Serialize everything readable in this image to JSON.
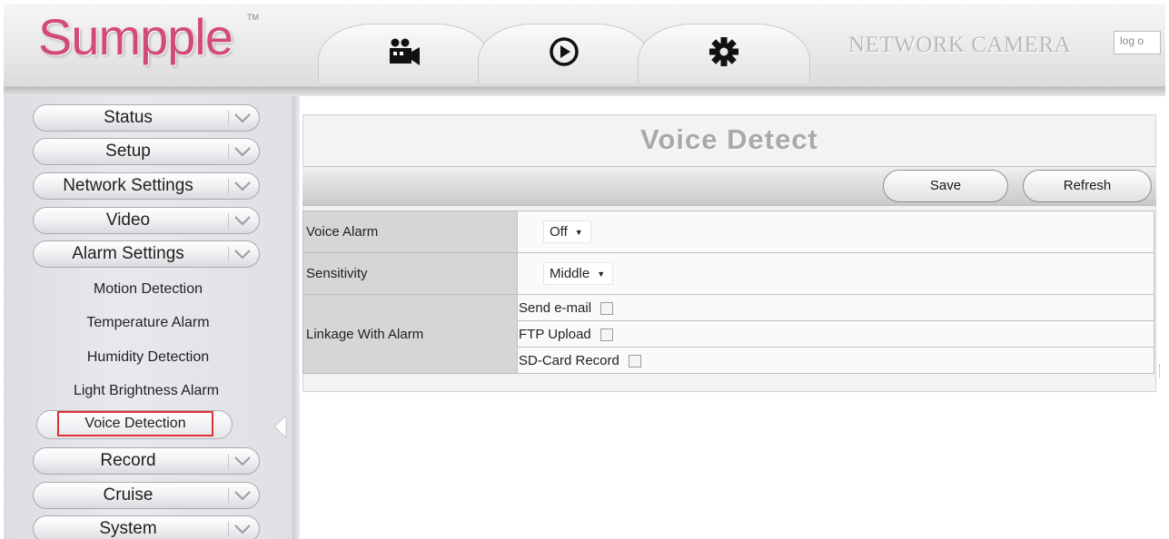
{
  "header": {
    "logo": "Sumpple",
    "logo_tm": "TM",
    "brand": "NETWORK CAMERA",
    "logout": "log o",
    "tabs": [
      {
        "name": "live-video",
        "icon": "video-camera-icon"
      },
      {
        "name": "playback",
        "icon": "play-circle-icon"
      },
      {
        "name": "settings",
        "icon": "gear-icon"
      }
    ]
  },
  "sidebar": {
    "menu": [
      {
        "label": "Status"
      },
      {
        "label": "Setup"
      },
      {
        "label": "Network Settings"
      },
      {
        "label": "Video"
      },
      {
        "label": "Alarm Settings"
      }
    ],
    "alarm_sub": [
      {
        "label": "Motion Detection"
      },
      {
        "label": "Temperature Alarm"
      },
      {
        "label": "Humidity Detection"
      },
      {
        "label": "Light Brightness Alarm"
      },
      {
        "label": "Voice Detection",
        "selected": true
      }
    ],
    "menu_bottom": [
      {
        "label": "Record"
      },
      {
        "label": "Cruise"
      },
      {
        "label": "System"
      }
    ]
  },
  "main": {
    "title": "Voice Detect",
    "save_label": "Save",
    "refresh_label": "Refresh",
    "rows": {
      "voice_alarm": {
        "label": "Voice Alarm",
        "value": "Off"
      },
      "sensitivity": {
        "label": "Sensitivity",
        "value": "Middle"
      },
      "linkage": {
        "label": "Linkage With Alarm",
        "options": [
          {
            "label": "Send e-mail",
            "checked": false
          },
          {
            "label": "FTP Upload",
            "checked": false
          },
          {
            "label": "SD-Card Record",
            "checked": false
          }
        ]
      }
    }
  },
  "colors": {
    "logo": "#d24a7b",
    "selected_outline": "#e0303a",
    "title_gray": "#a9a9a9"
  }
}
